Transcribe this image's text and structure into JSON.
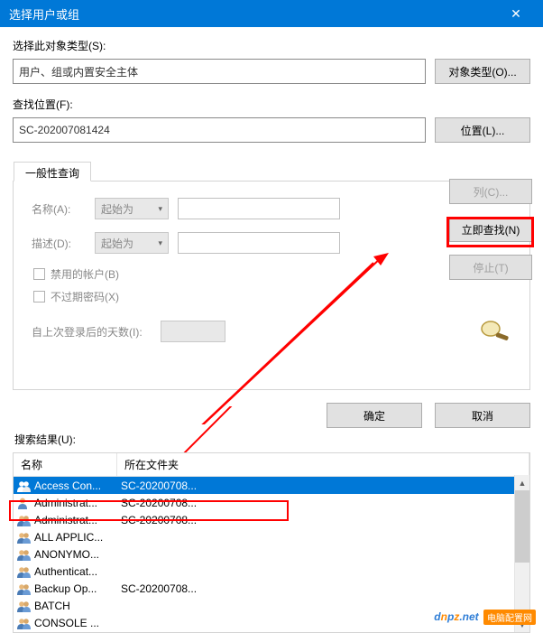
{
  "window": {
    "title": "选择用户或组"
  },
  "section1": {
    "label": "选择此对象类型(S):",
    "value": "用户、组或内置安全主体",
    "button": "对象类型(O)..."
  },
  "section2": {
    "label": "查找位置(F):",
    "value": "SC-202007081424",
    "button": "位置(L)..."
  },
  "tab": {
    "label": "一般性查询"
  },
  "form": {
    "name_label": "名称(A):",
    "name_combo": "起始为",
    "desc_label": "描述(D):",
    "desc_combo": "起始为",
    "disabled_check": "禁用的帐户(B)",
    "noexpire_check": "不过期密码(X)",
    "days_label": "自上次登录后的天数(I):"
  },
  "right": {
    "columns": "列(C)...",
    "findnow": "立即查找(N)",
    "stop": "停止(T)"
  },
  "okcancel": {
    "ok": "确定",
    "cancel": "取消"
  },
  "results": {
    "label": "搜索结果(U):",
    "col_name": "名称",
    "col_loc": "所在文件夹",
    "rows": [
      {
        "name": "Access Con...",
        "loc": "SC-20200708...",
        "type": "group",
        "selected": true
      },
      {
        "name": "Administrat...",
        "loc": "SC-20200708...",
        "type": "user"
      },
      {
        "name": "Administrat...",
        "loc": "SC-20200708...",
        "type": "group"
      },
      {
        "name": "ALL APPLIC...",
        "loc": "",
        "type": "group"
      },
      {
        "name": "ANONYMO...",
        "loc": "",
        "type": "group"
      },
      {
        "name": "Authenticat...",
        "loc": "",
        "type": "group"
      },
      {
        "name": "Backup Op...",
        "loc": "SC-20200708...",
        "type": "group"
      },
      {
        "name": "BATCH",
        "loc": "",
        "type": "group"
      },
      {
        "name": "CONSOLE ...",
        "loc": "",
        "type": "group"
      }
    ]
  },
  "watermark": {
    "text": "电脑配置网"
  }
}
